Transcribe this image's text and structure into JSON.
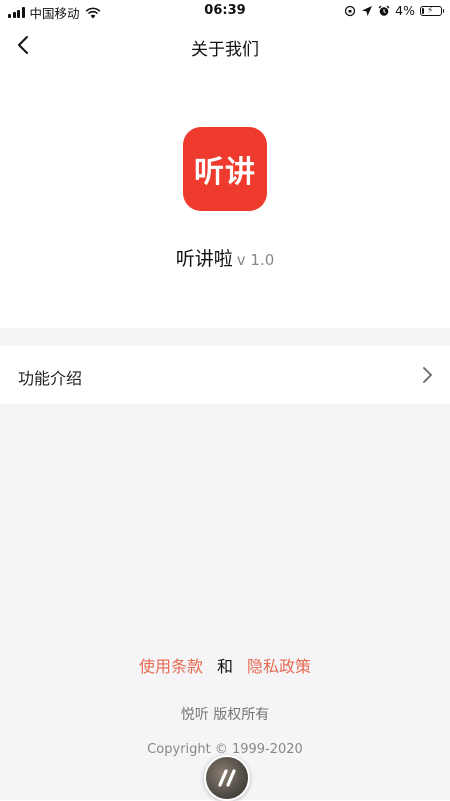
{
  "status_bar": {
    "carrier": "中国移动",
    "time": "06:39",
    "battery_percent_label": "4%",
    "battery_level": 0.04,
    "icons": [
      "signal-icon",
      "wifi-icon",
      "orientation-lock-icon",
      "location-icon",
      "alarm-icon",
      "battery-icon"
    ]
  },
  "header": {
    "title": "关于我们",
    "back_icon": "chevron-left-icon"
  },
  "app": {
    "logo_text": "听讲",
    "name": "听讲啦",
    "version": "v 1.0",
    "logo_color": "#ef3b2d"
  },
  "menu": {
    "items": [
      {
        "label": "功能介绍",
        "icon": "chevron-right-icon"
      }
    ]
  },
  "footer": {
    "terms_link": "使用条款",
    "conjunction": "和",
    "privacy_link": "隐私政策",
    "owner": "悦听 版权所有",
    "copyright": "Copyright © 1999-2020",
    "link_color": "#e86a52"
  }
}
